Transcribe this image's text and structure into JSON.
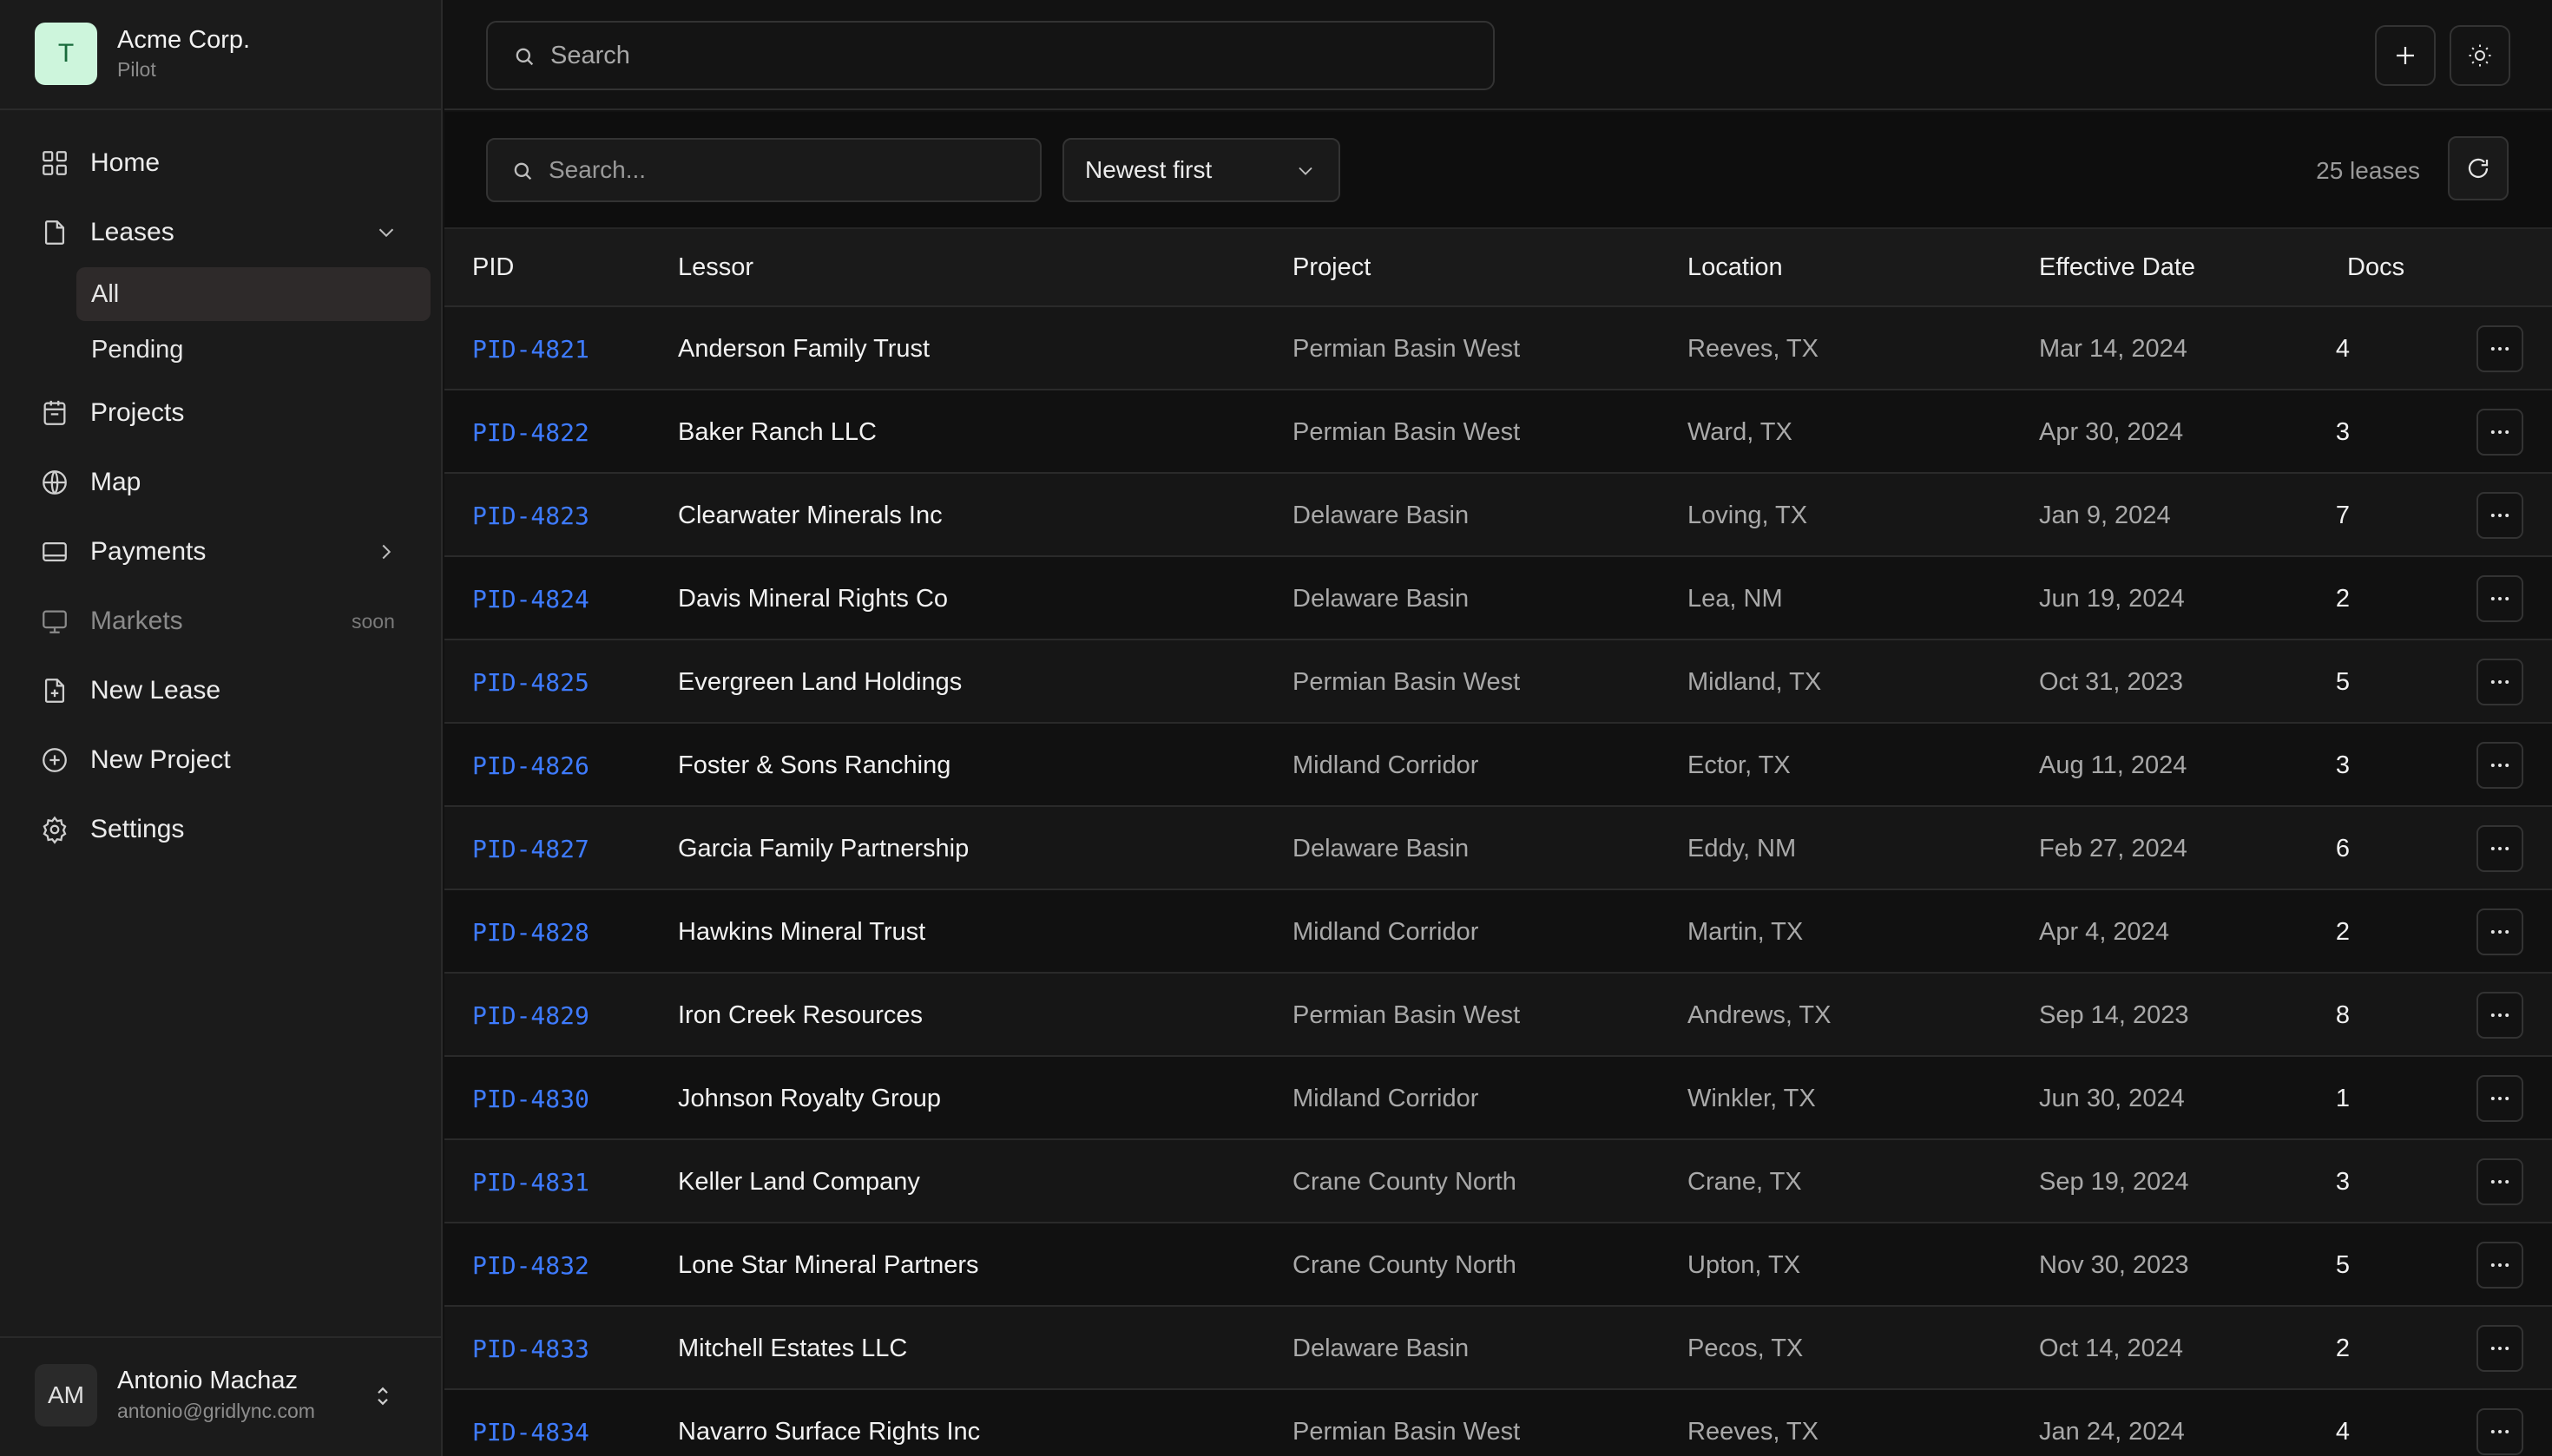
{
  "brand": {
    "logo_letter": "T",
    "name": "Acme Corp.",
    "subtitle": "Pilot"
  },
  "nav": {
    "home": "Home",
    "leases": "Leases",
    "leases_sub": {
      "all": "All",
      "pending": "Pending"
    },
    "projects": "Projects",
    "map": "Map",
    "payments": "Payments",
    "markets": "Markets",
    "markets_badge": "soon",
    "new_lease": "New Lease",
    "new_project": "New Project",
    "settings": "Settings"
  },
  "user": {
    "initials": "AM",
    "name": "Antonio Machaz",
    "email": "antonio@gridlync.com"
  },
  "topbar": {
    "search_placeholder": "Search"
  },
  "toolbar": {
    "search_placeholder": "Search...",
    "sort_value": "Newest first",
    "count": "25 leases"
  },
  "table": {
    "headers": {
      "pid": "PID",
      "lessor": "Lessor",
      "project": "Project",
      "location": "Location",
      "date": "Effective Date",
      "docs": "Docs"
    },
    "rows": [
      {
        "pid": "PID-4821",
        "lessor": "Anderson Family Trust",
        "project": "Permian Basin West",
        "location": "Reeves, TX",
        "date": "Mar 14, 2024",
        "docs": "4"
      },
      {
        "pid": "PID-4822",
        "lessor": "Baker Ranch LLC",
        "project": "Permian Basin West",
        "location": "Ward, TX",
        "date": "Apr 30, 2024",
        "docs": "3"
      },
      {
        "pid": "PID-4823",
        "lessor": "Clearwater Minerals Inc",
        "project": "Delaware Basin",
        "location": "Loving, TX",
        "date": "Jan 9, 2024",
        "docs": "7"
      },
      {
        "pid": "PID-4824",
        "lessor": "Davis Mineral Rights Co",
        "project": "Delaware Basin",
        "location": "Lea, NM",
        "date": "Jun 19, 2024",
        "docs": "2"
      },
      {
        "pid": "PID-4825",
        "lessor": "Evergreen Land Holdings",
        "project": "Permian Basin West",
        "location": "Midland, TX",
        "date": "Oct 31, 2023",
        "docs": "5"
      },
      {
        "pid": "PID-4826",
        "lessor": "Foster & Sons Ranching",
        "project": "Midland Corridor",
        "location": "Ector, TX",
        "date": "Aug 11, 2024",
        "docs": "3"
      },
      {
        "pid": "PID-4827",
        "lessor": "Garcia Family Partnership",
        "project": "Delaware Basin",
        "location": "Eddy, NM",
        "date": "Feb 27, 2024",
        "docs": "6"
      },
      {
        "pid": "PID-4828",
        "lessor": "Hawkins Mineral Trust",
        "project": "Midland Corridor",
        "location": "Martin, TX",
        "date": "Apr 4, 2024",
        "docs": "2"
      },
      {
        "pid": "PID-4829",
        "lessor": "Iron Creek Resources",
        "project": "Permian Basin West",
        "location": "Andrews, TX",
        "date": "Sep 14, 2023",
        "docs": "8"
      },
      {
        "pid": "PID-4830",
        "lessor": "Johnson Royalty Group",
        "project": "Midland Corridor",
        "location": "Winkler, TX",
        "date": "Jun 30, 2024",
        "docs": "1"
      },
      {
        "pid": "PID-4831",
        "lessor": "Keller Land Company",
        "project": "Crane County North",
        "location": "Crane, TX",
        "date": "Sep 19, 2024",
        "docs": "3"
      },
      {
        "pid": "PID-4832",
        "lessor": "Lone Star Mineral Partners",
        "project": "Crane County North",
        "location": "Upton, TX",
        "date": "Nov 30, 2023",
        "docs": "5"
      },
      {
        "pid": "PID-4833",
        "lessor": "Mitchell Estates LLC",
        "project": "Delaware Basin",
        "location": "Pecos, TX",
        "date": "Oct 14, 2024",
        "docs": "2"
      },
      {
        "pid": "PID-4834",
        "lessor": "Navarro Surface Rights Inc",
        "project": "Permian Basin West",
        "location": "Reeves, TX",
        "date": "Jan 24, 2024",
        "docs": "4"
      }
    ]
  },
  "colors": {
    "accent_link": "#3e7bff",
    "brand_logo_bg": "#cdf5dc",
    "background": "#121212",
    "sidebar": "#1b1b1b"
  },
  "icons": [
    "home-grid-icon",
    "file-icon",
    "calendar-icon",
    "globe-icon",
    "wallet-icon",
    "monitor-icon",
    "file-plus-icon",
    "plus-circle-icon",
    "gear-icon",
    "search-icon",
    "plus-icon",
    "sun-icon",
    "refresh-icon",
    "chevron-down-icon",
    "chevron-right-icon",
    "more-horizontal-icon",
    "chevrons-up-down-icon"
  ]
}
